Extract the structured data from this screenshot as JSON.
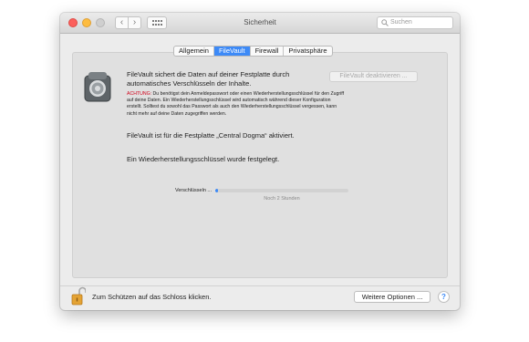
{
  "window": {
    "title": "Sicherheit",
    "search_placeholder": "Suchen",
    "nav_back_icon": "chevron-left-icon",
    "nav_forward_icon": "chevron-right-icon",
    "grid_icon": "grid-icon"
  },
  "tabs": [
    {
      "label": "Allgemein",
      "active": false
    },
    {
      "label": "FileVault",
      "active": true
    },
    {
      "label": "Firewall",
      "active": false
    },
    {
      "label": "Privatsphäre",
      "active": false
    }
  ],
  "filevault": {
    "intro_line1": "FileVault sichert die Daten auf deiner Festplatte durch",
    "intro_line2": "automatisches Verschlüsseln der Inhalte.",
    "disable_button": "FileVault deaktivieren ...",
    "warning_label": "ACHTUNG:",
    "warning_line1": " Du benötigst dein Anmeldepasswort oder einen Wiederherstellungsschlüssel für den Zugriff",
    "warning_line2": "auf deine Daten. Ein Wiederherstellungsschlüssel wird automatisch während dieser Konfiguration",
    "warning_line3": "erstellt. Solltest du sowohl das Passwort als auch den Wiederherstellungsschlüssel vergessen, kann",
    "warning_line4": "nicht mehr auf deine Daten zugegriffen werden.",
    "status_active": "FileVault ist für die Festplatte „Central Dogma“ aktiviert.",
    "status_key": "Ein Wiederherstellungsschlüssel wurde festgelegt.",
    "encrypting_label": "Verschlüsseln ...",
    "progress_fraction": 0.02,
    "remaining": "Noch 2 Stunden"
  },
  "footer": {
    "lock_text": "Zum Schützen auf das Schloss klicken.",
    "more_options": "Weitere Optionen ...",
    "help": "?"
  },
  "colors": {
    "accent": "#3d8af7",
    "warning": "#d0021b"
  }
}
